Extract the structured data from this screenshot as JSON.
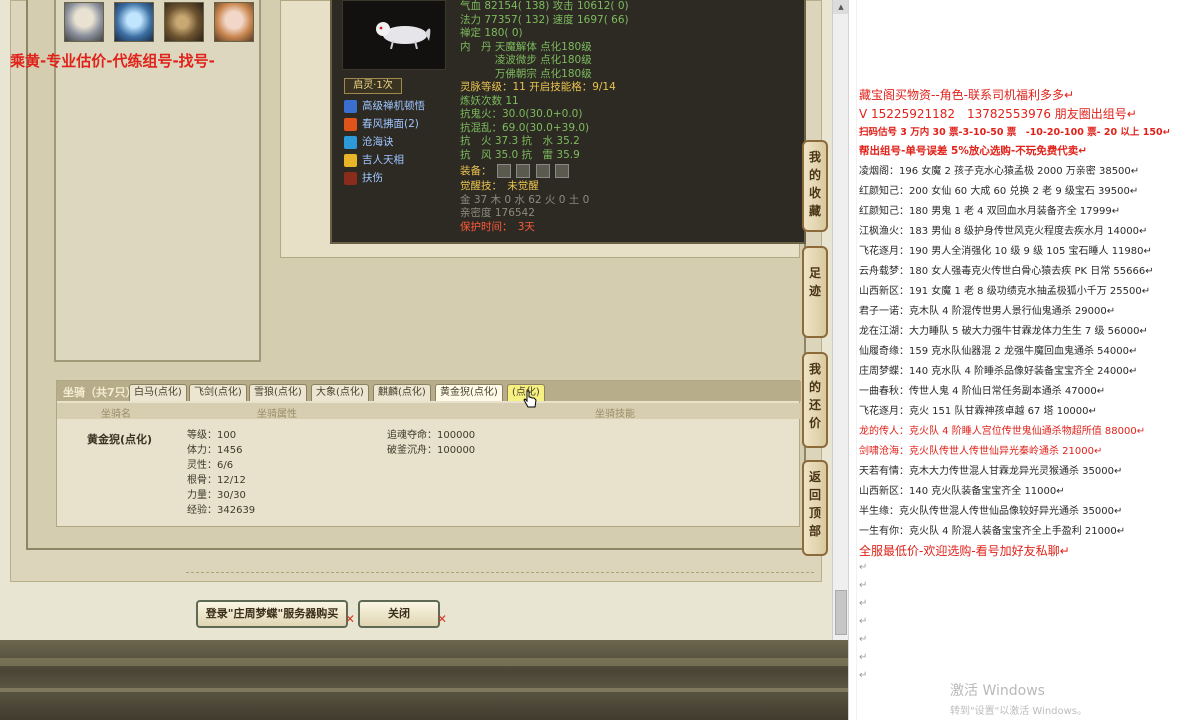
{
  "pet_box": {
    "tag": "启灵·1次",
    "skills": [
      "高级禅机顿悟",
      "春风拂面(2)",
      "沧海诀",
      "吉人天相",
      "扶伤"
    ],
    "stats": [
      {
        "text": "气血 82154( 138) 攻击 10612( 0)",
        "cls": ""
      },
      {
        "text": "法力 77357( 132) 速度 1697( 66)",
        "cls": ""
      },
      {
        "text": "禅定 180( 0)",
        "cls": ""
      },
      {
        "text": "内　丹 天魔解体 点化180级",
        "cls": ""
      },
      {
        "text": "　　　 凌波微步 点化180级",
        "cls": ""
      },
      {
        "text": "　　　 万佛朝宗 点化180级",
        "cls": ""
      },
      {
        "text": "灵脉等级：11 开启技能格：9/14",
        "cls": "gold"
      },
      {
        "text": "炼妖次数 11",
        "cls": ""
      },
      {
        "text": "抗鬼火：30.0(30.0+0.0)",
        "cls": ""
      },
      {
        "text": "抗混乱：69.0(30.0+39.0)",
        "cls": ""
      },
      {
        "text": "抗　火 37.3 抗　水 35.2",
        "cls": ""
      },
      {
        "text": "抗　风 35.0 抗　雷 35.9",
        "cls": ""
      }
    ],
    "equip_label": "装备：",
    "awaken": "觉醒技：　未觉醒",
    "elements": "金 37 木 0 水 62 火 0 土 0",
    "intimacy": "亲密度 176542",
    "protect": "保护时间：　3天"
  },
  "mount": {
    "title": "坐骑（共7只）",
    "tabs": [
      "白马(点化)",
      "飞剑(点化)",
      "雪狼(点化)",
      "大象(点化)",
      "麒麟(点化)",
      "黄金猊(点化)",
      "(点化)"
    ],
    "headers": [
      "坐骑名",
      "坐骑属性",
      "坐骑技能"
    ],
    "name": "黄金猊(点化)",
    "props": [
      "等级：100",
      "体力：1456",
      "灵性：6/6",
      "根骨：12/12",
      "力量：30/30",
      "经验：342639"
    ],
    "skills": [
      "追魂夺命：100000",
      "破釜沉舟：100000"
    ]
  },
  "side_tabs": [
    "我的收藏",
    "足迹",
    "我的还价",
    "返回顶部"
  ],
  "buttons": {
    "login": "登录\"庄周梦蝶\"服务器购买",
    "close": "关闭"
  },
  "doc": {
    "title": "乘黄-专业估价-代练组号-找号-",
    "lines": [
      {
        "text": "藏宝阁买物资--角色-联系司机福利多多↵",
        "cls": "red",
        "size": 12
      },
      {
        "text": "V 15225921182　13782553976 朋友圈出组号↵",
        "cls": "red",
        "size": 12
      },
      {
        "text": "扫码估号 3 万内 30 票-3-10-50 票　-10-20-100 票- 20 以上 150↵",
        "cls": "red bold",
        "size": 9.5
      },
      {
        "text": "帮出组号-单号误差 5%放心选购-不玩免费代卖↵",
        "cls": "red bold",
        "size": 10.5
      },
      {
        "text": "凌烟阁：196 女魔 2 孩子克水心猿孟极 2000 万亲密 38500↵",
        "cls": "dark",
        "size": 10
      },
      {
        "text": "红颜知己：200 女仙 60 大成 60 兑换 2 老 9 级宝石 39500↵",
        "cls": "dark",
        "size": 10
      },
      {
        "text": "红颜知己：180 男鬼 1 老 4 双回血水月装备齐全 17999↵",
        "cls": "dark",
        "size": 10
      },
      {
        "text": "江枫渔火：183 男仙 8 级护身传世风克火程度去疾水月 14000↵",
        "cls": "dark",
        "size": 10
      },
      {
        "text": "飞花逐月：190 男人全消强化 10 级 9 级 105 宝石睡人 11980↵",
        "cls": "dark",
        "size": 10
      },
      {
        "text": "云舟载梦：180 女人强毒克火传世白骨心猿去疾 PK 日常 55666↵",
        "cls": "dark",
        "size": 10
      },
      {
        "text": "山西新区：191 女魔 1 老 8 级功绩克水抽孟极狐小千万 25500↵",
        "cls": "dark",
        "size": 10
      },
      {
        "text": "君子一诺：克木队 4 阶混传世男人景行仙鬼通杀 29000↵",
        "cls": "dark",
        "size": 10
      },
      {
        "text": "龙在江湖：大力睡队 5 破大力强牛甘霖龙体力生生 7 级 56000↵",
        "cls": "dark",
        "size": 10
      },
      {
        "text": "仙履奇缘：159 克水队仙器混 2 龙强牛魔回血鬼通杀 54000↵",
        "cls": "dark",
        "size": 10
      },
      {
        "text": "庄周梦蝶：140 克水队 4 阶睡杀品像好装备宝宝齐全 24000↵",
        "cls": "dark",
        "size": 10
      },
      {
        "text": "一曲春秋：传世人鬼 4 阶仙日常任务副本通杀 47000↵",
        "cls": "dark",
        "size": 10
      },
      {
        "text": "飞花逐月：克火 151 队甘霖神孩卓越 67 塔 10000↵",
        "cls": "dark",
        "size": 10
      },
      {
        "text": "龙的传人：克火队 4 阶睡人宫位传世鬼仙通杀物超所值 88000↵",
        "cls": "red",
        "size": 10
      },
      {
        "text": "剑啸沧海：克火队传世人传世仙异光秦岭通杀 21000↵",
        "cls": "red",
        "size": 10
      },
      {
        "text": "天若有情：克木大力传世混人甘霖龙异光灵猴通杀 35000↵",
        "cls": "dark",
        "size": 10
      },
      {
        "text": "山西新区：140 克火队装备宝宝齐全 11000↵",
        "cls": "dark",
        "size": 10
      },
      {
        "text": "半生缘：克火队传世混人传世仙品像较好异光通杀 35000↵",
        "cls": "dark",
        "size": 10
      },
      {
        "text": "一生有你：克火队 4 阶混人装备宝宝齐全上手盈利 21000↵",
        "cls": "dark",
        "size": 10
      },
      {
        "text": "全服最低价-欢迎选购-看号加好友私聊↵",
        "cls": "red",
        "size": 12
      }
    ],
    "empty_marks": [
      "↵",
      "↵",
      "↵",
      "↵",
      "↵",
      "↵",
      "↵"
    ],
    "activate_title": "激活 Windows",
    "activate_sub": "转到\"设置\"以激活 Windows。"
  },
  "colors": {
    "accent_red": "#e0221a",
    "pet_stat_green": "#7dbb5e",
    "pet_gold": "#e9c34e"
  }
}
